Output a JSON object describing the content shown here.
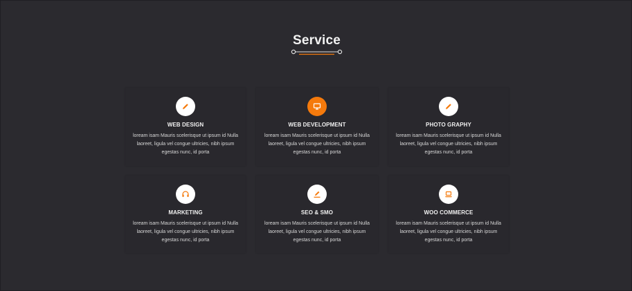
{
  "section": {
    "title": "Service"
  },
  "colors": {
    "background": "#2b2a2f",
    "card": "#29282d",
    "accent": "#f57a0c",
    "icon_circle": "#ffffff"
  },
  "services": [
    {
      "title": "WEB DESIGN",
      "icon": "pencil-icon",
      "active": false,
      "description": "loream isam Mauris scelerisque ut ipsum id Nulla laoreet, ligula vel congue ultricies, nibh ipsum egestas nunc, id porta"
    },
    {
      "title": "WEB DEVELOPMENT",
      "icon": "monitor-icon",
      "active": true,
      "description": "loream isam Mauris scelerisque ut ipsum id Nulla laoreet, ligula vel congue ultricies, nibh ipsum egestas nunc, id porta"
    },
    {
      "title": "PHOTO GRAPHY",
      "icon": "pencil-icon",
      "active": false,
      "description": "loream isam Mauris scelerisque ut ipsum id Nulla laoreet, ligula vel congue ultricies, nibh ipsum egestas nunc, id porta"
    },
    {
      "title": "MARKETING",
      "icon": "headphones-icon",
      "active": false,
      "description": "loream isam Mauris scelerisque ut ipsum id Nulla laoreet, ligula vel congue ultricies, nibh ipsum egestas nunc, id porta"
    },
    {
      "title": "SEO & SMO",
      "icon": "edit-icon",
      "active": false,
      "description": "loream isam Mauris scelerisque ut ipsum id Nulla laoreet, ligula vel congue ultricies, nibh ipsum egestas nunc, id porta"
    },
    {
      "title": "WOO COMMERCE",
      "icon": "laptop-icon",
      "active": false,
      "description": "loream isam Mauris scelerisque ut ipsum id Nulla laoreet, ligula vel congue ultricies, nibh ipsum egestas nunc, id porta"
    }
  ]
}
